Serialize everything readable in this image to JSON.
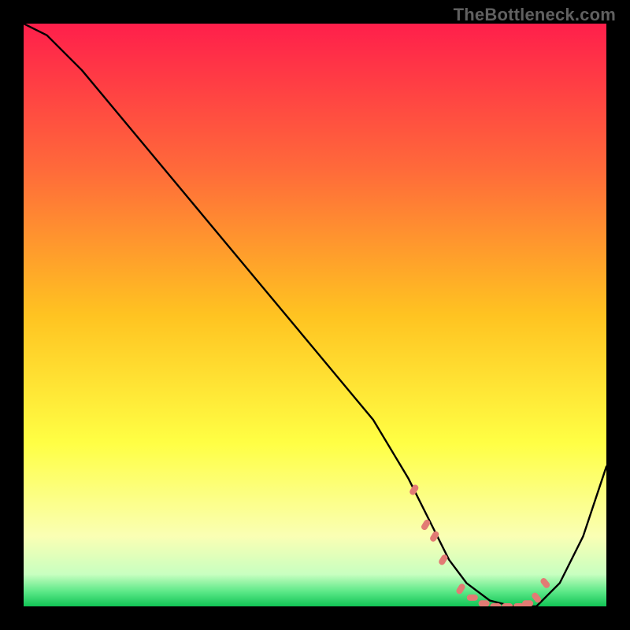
{
  "watermark": "TheBottleneck.com",
  "chart_data": {
    "type": "line",
    "title": "",
    "xlabel": "",
    "ylabel": "",
    "xlim": [
      0,
      100
    ],
    "ylim": [
      0,
      100
    ],
    "x": [
      0,
      4,
      10,
      20,
      30,
      40,
      50,
      60,
      66,
      70,
      73,
      76,
      80,
      84,
      86,
      88,
      92,
      96,
      100
    ],
    "values": [
      100,
      98,
      92,
      80,
      68,
      56,
      44,
      32,
      22,
      14,
      8,
      4,
      1,
      0,
      0,
      0,
      4,
      12,
      24
    ],
    "series": [
      {
        "name": "curve",
        "x": [
          0,
          4,
          10,
          20,
          30,
          40,
          50,
          60,
          66,
          70,
          73,
          76,
          80,
          84,
          86,
          88,
          92,
          96,
          100
        ],
        "y": [
          100,
          98,
          92,
          80,
          68,
          56,
          44,
          32,
          22,
          14,
          8,
          4,
          1,
          0,
          0,
          0,
          4,
          12,
          24
        ]
      }
    ],
    "markers": {
      "color": "#e27b74",
      "points_x": [
        67,
        69,
        70.5,
        72,
        75,
        77,
        79,
        81,
        83,
        85,
        86.5,
        88,
        89.5
      ],
      "points_y": [
        20,
        14,
        12,
        8,
        3,
        1.5,
        0.5,
        0,
        0,
        0,
        0.5,
        1.5,
        4
      ]
    },
    "gradient_stops": [
      {
        "offset": 0.0,
        "color": "#ff1f4b"
      },
      {
        "offset": 0.25,
        "color": "#ff6a3a"
      },
      {
        "offset": 0.5,
        "color": "#ffc321"
      },
      {
        "offset": 0.72,
        "color": "#ffff44"
      },
      {
        "offset": 0.88,
        "color": "#faffb4"
      },
      {
        "offset": 0.945,
        "color": "#c8ffc0"
      },
      {
        "offset": 0.975,
        "color": "#5be887"
      },
      {
        "offset": 1.0,
        "color": "#11c455"
      }
    ]
  }
}
